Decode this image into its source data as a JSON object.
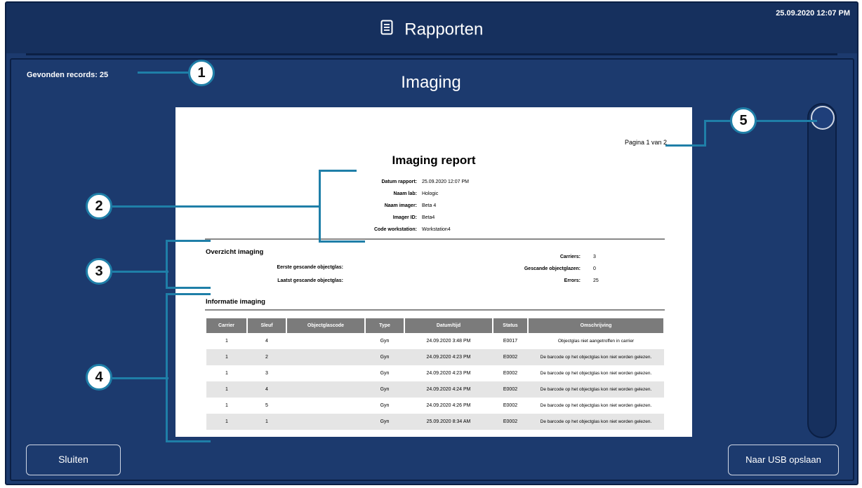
{
  "header": {
    "title": "Rapporten",
    "datetime": "25.09.2020 12:07 PM",
    "title_icon": "document-icon"
  },
  "main": {
    "records_label": "Gevonden records:",
    "records_count": "25",
    "section_title": "Imaging"
  },
  "report": {
    "page_label": "Pagina 1 van 2",
    "title": "Imaging report",
    "meta": [
      {
        "key": "Datum rapport:",
        "value": "25.09.2020 12:07 PM"
      },
      {
        "key": "Naam lab:",
        "value": "Hologic"
      },
      {
        "key": "Naam imager:",
        "value": "Beta 4"
      },
      {
        "key": "Imager ID:",
        "value": "Beta4"
      },
      {
        "key": "Code workstation:",
        "value": "Workstation4"
      }
    ],
    "overview": {
      "heading": "Overzicht imaging",
      "first_label": "Eerste gescande objectglas:",
      "last_label": "Laatst gescande objectglas:",
      "carriers_label": "Carriers:",
      "carriers_value": "3",
      "scanned_label": "Gescande objectglazen:",
      "scanned_value": "0",
      "errors_label": "Errors:",
      "errors_value": "25"
    },
    "info": {
      "heading": "Informatie imaging",
      "columns": [
        "Carrier",
        "Sleuf",
        "Objectglascode",
        "Type",
        "Datum/tijd",
        "Status",
        "Omschrijving"
      ],
      "rows": [
        [
          "1",
          "4",
          "",
          "Gyn",
          "24.09.2020 3:48 PM",
          "E0017",
          "Objectglas niet aangetroffen in carrier"
        ],
        [
          "1",
          "2",
          "",
          "Gyn",
          "24.09.2020 4:23 PM",
          "E0002",
          "De barcode op het objectglas kon niet worden gelezen."
        ],
        [
          "1",
          "3",
          "",
          "Gyn",
          "24.09.2020 4:23 PM",
          "E0002",
          "De barcode op het objectglas kon niet worden gelezen."
        ],
        [
          "1",
          "4",
          "",
          "Gyn",
          "24.09.2020 4:24 PM",
          "E0002",
          "De barcode op het objectglas kon niet worden gelezen."
        ],
        [
          "1",
          "5",
          "",
          "Gyn",
          "24.09.2020 4:26 PM",
          "E0002",
          "De barcode op het objectglas kon niet worden gelezen."
        ],
        [
          "1",
          "1",
          "",
          "Gyn",
          "25.09.2020 8:34 AM",
          "E0002",
          "De barcode op het objectglas kon niet worden gelezen."
        ]
      ]
    }
  },
  "buttons": {
    "close": "Sluiten",
    "usb": "Naar USB opslaan"
  },
  "callouts": [
    "1",
    "2",
    "3",
    "4",
    "5"
  ],
  "colors": {
    "background": "#1c3a6e",
    "header": "#16305e",
    "callout_accent": "#1f7fa8"
  }
}
